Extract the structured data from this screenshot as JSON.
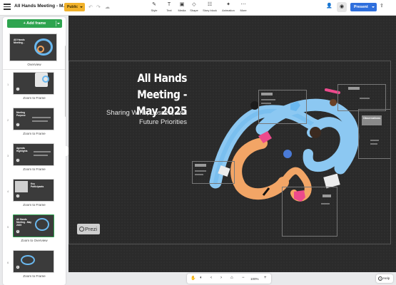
{
  "topbar": {
    "title": "All Hands Meeting - M...",
    "visibility": "Public",
    "tools": [
      {
        "icon": "style-icon",
        "glyph": "✎",
        "label": "Style"
      },
      {
        "icon": "text-icon",
        "glyph": "T",
        "label": "Text"
      },
      {
        "icon": "media-icon",
        "glyph": "▣",
        "label": "Media"
      },
      {
        "icon": "shape-icon",
        "glyph": "◇",
        "label": "Shape"
      },
      {
        "icon": "story-block-icon",
        "glyph": "☷",
        "label": "Story block"
      },
      {
        "icon": "animation-icon",
        "glyph": "✦",
        "label": "Animation"
      },
      {
        "icon": "more-icon",
        "glyph": "⋯",
        "label": "More"
      }
    ],
    "present_label": "Present"
  },
  "sidebar": {
    "add_frame_label": "+ Add frame",
    "overview_label": "Overview",
    "frames": [
      {
        "num": "1",
        "title": "",
        "label": "Zoom to Frame"
      },
      {
        "num": "2",
        "title": "Meeting Purpose",
        "label": "Zoom to Frame"
      },
      {
        "num": "3",
        "title": "Agenda Highlights",
        "label": "Zoom to Frame"
      },
      {
        "num": "4",
        "title": "Key Participants",
        "label": "Zoom to Frame"
      },
      {
        "num": "5",
        "title": "All Hands Meeting - May 2025",
        "label": "Zoom to Overview"
      },
      {
        "num": "6",
        "title": "",
        "label": "Zoom to Frame"
      }
    ]
  },
  "canvas": {
    "title_line1": "All Hands Meeting -",
    "title_line2": "May 2025",
    "subtitle_line1": "Sharing Wins, Losses, and",
    "subtitle_line2": "Future Priorities",
    "logo_text": "Prezi",
    "observations_label": "Observations"
  },
  "bottombar": {
    "zoom": "100%"
  },
  "help_label": "Help",
  "colors": {
    "present": "#2f6fdd",
    "add_frame": "#2ea44f",
    "public": "#f1b22b",
    "canvas": "#2a2a2a"
  }
}
